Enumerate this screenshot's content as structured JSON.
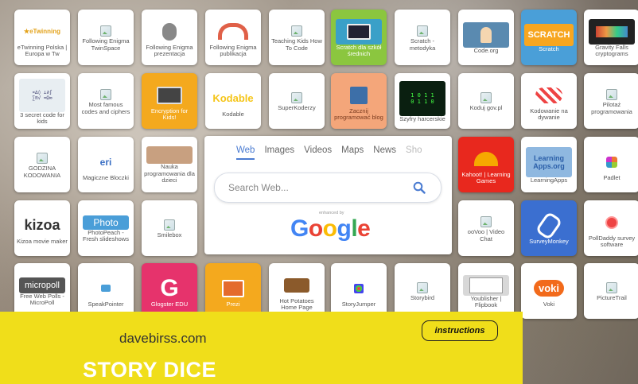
{
  "tiles": [
    {
      "label": "eTwinning Polska | Europa w Tw"
    },
    {
      "label": "Following Enigma TwinSpace"
    },
    {
      "label": "Following Enigma prezentacja"
    },
    {
      "label": "Following Enigma publikacja"
    },
    {
      "label": "Teaching Kids How To Code"
    },
    {
      "label": "Scratch dla szkół średnich"
    },
    {
      "label": "Scratch - metodyka"
    },
    {
      "label": "Code.org"
    },
    {
      "label": "Scratch",
      "logo": "SCRATCH"
    },
    {
      "label": "Gravity Falls cryptograms"
    },
    {
      "label": "3 secret code for kids"
    },
    {
      "label": "Most famous codes and ciphers"
    },
    {
      "label": "Encryption for Kids!"
    },
    {
      "label": "Kodable",
      "logo": "Kodable"
    },
    {
      "label": "SuperKoderzy"
    },
    {
      "label": "Zacznij programować blog"
    },
    {
      "label": "Szyfry harcerskie"
    },
    {
      "label": "Koduj gov.pl"
    },
    {
      "label": "Kodowanie na dywanie"
    },
    {
      "label": "Pilotaż programowania"
    },
    {
      "label": "GODZINA KODOWANIA"
    },
    {
      "label": "Magiczne Bloczki",
      "logo": "eri"
    },
    {
      "label": "Nauka programowania dla dzieci"
    },
    {
      "label": "Kahoot! | Learning Games"
    },
    {
      "label": "LearningApps",
      "logo": "Learning Apps.org"
    },
    {
      "label": "Padlet"
    },
    {
      "label": "Kizoa movie maker",
      "logo": "kizoa"
    },
    {
      "label": "PhotoPeach - Fresh slideshows",
      "logo": "Photo"
    },
    {
      "label": "Smilebox"
    },
    {
      "label": "ooVoo | Video Chat"
    },
    {
      "label": "SurveyMonkey"
    },
    {
      "label": "PollDaddy survey software"
    },
    {
      "label": "Free Web Polls - MicroPoll",
      "logo": "micropoll"
    },
    {
      "label": "SpeakPointer"
    },
    {
      "label": "Glogster EDU",
      "logo": "G"
    },
    {
      "label": "Prezi"
    },
    {
      "label": "Hot Potatoes Home Page"
    },
    {
      "label": "StoryJumper"
    },
    {
      "label": "Storybird"
    },
    {
      "label": "Youblisher | Flipbook"
    },
    {
      "label": "Voki",
      "logo": "voki"
    },
    {
      "label": "PictureTrail"
    }
  ],
  "search": {
    "tabs": [
      "Web",
      "Images",
      "Videos",
      "Maps",
      "News",
      "Sho"
    ],
    "placeholder": "Search Web...",
    "enhanced": "enhanced by",
    "logo": [
      "G",
      "o",
      "o",
      "g",
      "l",
      "e"
    ]
  },
  "banner": {
    "site": "davebirss.com",
    "title": "STORY DICE",
    "instructions": "instructions"
  },
  "colors": {
    "google_blue": "#4285f4",
    "google_red": "#ea4335",
    "google_yellow": "#fbbc05",
    "google_green": "#34a853",
    "banner_yellow": "#f0de1a"
  }
}
